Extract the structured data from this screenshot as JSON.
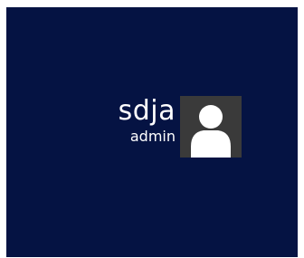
{
  "account": {
    "user_name": "sdja",
    "role": "admin",
    "avatar_icon": "user-silhouette-icon"
  },
  "colors": {
    "background": "#051343",
    "avatar_background": "#3a3a3a",
    "text": "#ffffff"
  }
}
